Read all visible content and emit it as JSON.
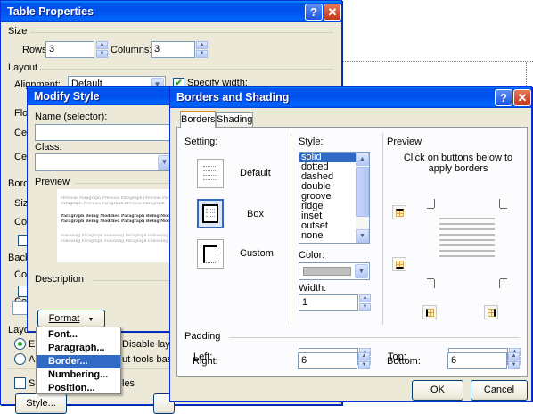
{
  "table_properties": {
    "title": "Table Properties",
    "help_glyph": "?",
    "close_glyph": "✕",
    "size_group": "Size",
    "rows_label": "Rows:",
    "rows_value": "3",
    "columns_label": "Columns:",
    "columns_value": "3",
    "layout_group": "Layout",
    "alignment_label": "Alignment:",
    "alignment_value": "Default",
    "specify_width_label": "Specify width:",
    "partial_float": "Flo",
    "partial_cell1": "Cell",
    "partial_cell2": "Cell",
    "partial_borders": "Borde",
    "partial_size": "Size",
    "partial_coll1": "Coll",
    "partial_backg": "Backg",
    "partial_coll2": "Coll",
    "partial_coll3": "Coll",
    "partial_layout": "Layou",
    "partial_en": "En",
    "partial_au": "Au",
    "partial_se": "Se",
    "disable_layout": "Disable layout",
    "tools_based": "ut tools based",
    "partial_les": "les",
    "style_button": "Style..."
  },
  "modify_style": {
    "title": "Modify Style",
    "name_label": "Name (selector):",
    "class_label": "Class:",
    "preview_group": "Preview",
    "preview_lines": [
      "Previous Paragraph Previous Paragraph Previous Paragraph",
      "Paragraph Previous Paragraph Previous Paragraph",
      "Paragraph Being Modified Paragraph Being Modified",
      "Paragraph Being Modified Paragraph Being Modified Paragraph",
      "Following Paragraph Following Paragraph Following Paragraph",
      "Following Paragraph Following Paragraph Following"
    ],
    "description_group": "Description",
    "format_button": "Format",
    "format_arrow": "▼"
  },
  "format_menu": {
    "items": [
      "Font...",
      "Paragraph...",
      "Border...",
      "Numbering...",
      "Position..."
    ],
    "highlighted_index": 2
  },
  "borders_shading": {
    "title": "Borders and Shading",
    "help_glyph": "?",
    "close_glyph": "✕",
    "tabs": [
      "Borders",
      "Shading"
    ],
    "active_tab": "Borders",
    "setting_label": "Setting:",
    "settings": [
      "Default",
      "Box",
      "Custom"
    ],
    "selected_setting": "Box",
    "style_label": "Style:",
    "styles": [
      "solid",
      "dotted",
      "dashed",
      "double",
      "groove",
      "ridge",
      "inset",
      "outset",
      "none"
    ],
    "selected_style": "solid",
    "color_label": "Color:",
    "width_label": "Width:",
    "width_value": "1",
    "preview_label": "Preview",
    "preview_hint": "Click on buttons below to apply borders",
    "padding_label": "Padding",
    "left_label": "Left:",
    "left_value": "6",
    "right_label": "Right:",
    "right_value": "6",
    "top_label": "Top:",
    "top_value": "6",
    "bottom_label": "Bottom:",
    "bottom_value": "6",
    "ok_button": "OK",
    "cancel_button": "Cancel"
  },
  "colors": {
    "title_blue": "#0054e3",
    "selection_blue": "#316ac5",
    "dialog_face": "#ece9d8",
    "close_red": "#c2361a",
    "check_green": "#21a121"
  }
}
